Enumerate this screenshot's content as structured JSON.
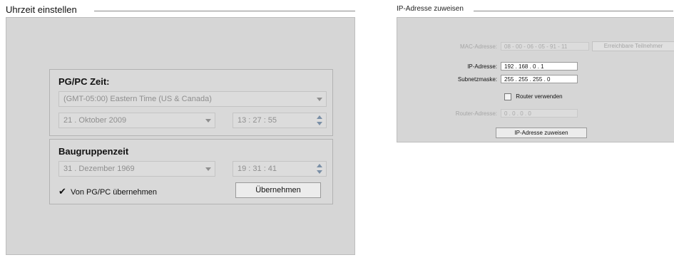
{
  "time_panel": {
    "title": "Uhrzeit einstellen",
    "pgpc_group": {
      "heading": "PG/PC Zeit:",
      "timezone": "(GMT-05:00) Eastern Time (US & Canada)",
      "date": "21 . Oktober  2009",
      "time": "13 : 27 : 55"
    },
    "module_group": {
      "heading": "Baugruppenzeit",
      "date": "31 . Dezember  1969",
      "time": "19 : 31 : 41",
      "checkbox_label": "Von PG/PC übernehmen",
      "checkbox_checked": true,
      "apply_button": "Übernehmen"
    }
  },
  "ip_panel": {
    "title": "IP-Adresse zuweisen",
    "mac_label": "MAC-Adresse:",
    "mac_value": "08 - 00 - 06 - 05 - 91 - 11",
    "reachable_button": "Erreichbare Teilnehmer",
    "ip_label": "IP-Adresse:",
    "ip_value": "192 . 168 . 0    . 1",
    "subnet_label": "Subnetzmaske:",
    "subnet_value": "255 . 255 . 255 . 0",
    "router_checkbox_label": "Router verwenden",
    "router_checkbox_checked": false,
    "router_label": "Router-Adresse:",
    "router_value": "0    . 0    . 0    . 0",
    "assign_button": "IP-Adresse zuweisen"
  },
  "colors": {
    "panel_bg": "#d6d6d6",
    "disabled_text": "#8f8f8f",
    "spinner": "#7a8fa6"
  }
}
